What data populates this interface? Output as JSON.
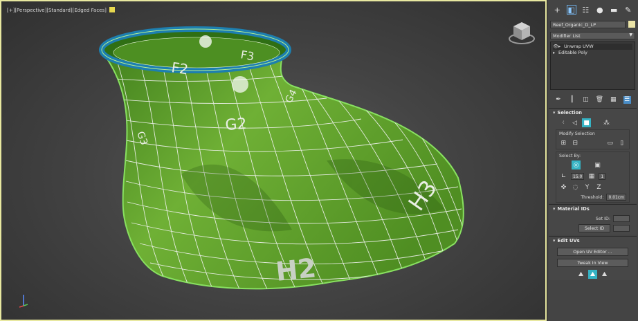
{
  "viewport": {
    "label": "[+][Perspective][Standard][Edged Faces]",
    "texture_labels": [
      "F2",
      "F3",
      "G2",
      "G3",
      "G4",
      "H2",
      "H3"
    ]
  },
  "panel": {
    "object_name": "Reef_Organic_D_LP",
    "modifier_list": "Modifier List",
    "stack": [
      "Unwrap UVW",
      "Editable Poly"
    ],
    "selection": {
      "title": "Selection",
      "modify_selection": "Modify Selection",
      "select_by": "Select By:",
      "angle_value": "15.0",
      "count_value": "1",
      "threshold_label": "Threshold:",
      "threshold_value": "0.01cm"
    },
    "material_ids": {
      "title": "Material IDs",
      "set_id": "Set ID:",
      "select_id": "Select ID"
    },
    "edit_uvs": {
      "title": "Edit UVs",
      "open_uv_editor": "Open UV Editor ...",
      "tweak_in_view": "Tweak In View"
    }
  },
  "colors": {
    "mesh_green": "#6aa92f",
    "rim_blue": "#1d7fb0",
    "selection_cyan": "#35b3c4",
    "viewport_border": "#e8e8a0"
  }
}
